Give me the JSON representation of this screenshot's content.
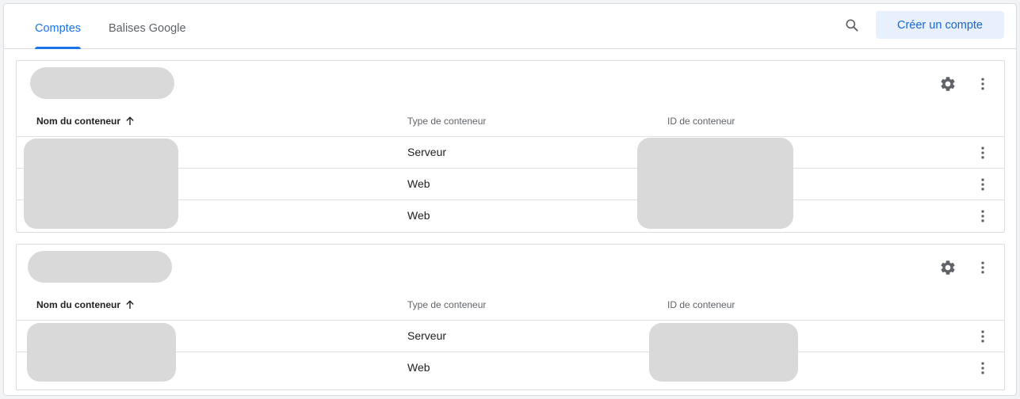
{
  "tabs": [
    {
      "label": "Comptes",
      "active": true
    },
    {
      "label": "Balises Google",
      "active": false
    }
  ],
  "actions": {
    "create_account_label": "Créer un compte"
  },
  "accounts": [
    {
      "table_headers": {
        "name": "Nom du conteneur",
        "type": "Type de conteneur",
        "id": "ID de conteneur"
      },
      "rows": [
        {
          "type": "Serveur"
        },
        {
          "type": "Web"
        },
        {
          "type": "Web"
        }
      ]
    },
    {
      "table_headers": {
        "name": "Nom du conteneur",
        "type": "Type de conteneur",
        "id": "ID de conteneur"
      },
      "rows": [
        {
          "type": "Serveur"
        },
        {
          "type": "Web"
        }
      ]
    }
  ],
  "colors": {
    "accent": "#1a73e8",
    "button_bg": "#e8f0fe",
    "redaction": "#d9d9d9"
  }
}
